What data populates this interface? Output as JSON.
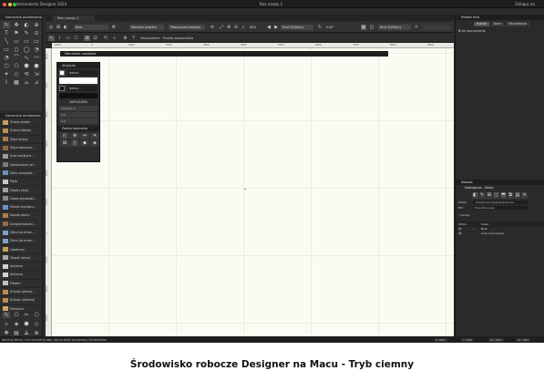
{
  "window": {
    "app_title": "Vectorworks Designer 2020",
    "document_title": "Bez nazwy 1",
    "sign_in": "Zaloguj się"
  },
  "basic_palette": {
    "title": "Narzędzia podstawowe",
    "tools": [
      "↖",
      "✥",
      "◐",
      "⊕",
      "T",
      "⚑",
      "✎",
      "⊙",
      "╲",
      "▭",
      "▭",
      "▭",
      "▭",
      "◻",
      "◯",
      "◔",
      "◔",
      "⌒",
      "∿",
      "〰",
      "⬡",
      "⬠",
      "⬢",
      "⬣",
      "✦",
      "◇",
      "⟲",
      "⇲",
      "⌇",
      "▦",
      "⌓",
      "⊿"
    ]
  },
  "tool_sets": {
    "title": "Narzędzia dodatkowe",
    "items": [
      "Ściana prosta",
      "Ściana łukowa",
      "Złącz ściany",
      "Złącz kompone...",
      "Ściel zwykłymi...",
      "Zakończenie ści...",
      "Skłon przegrod...",
      "Płyta",
      "Otwórz płyty",
      "Ustaw wysokość...",
      "Pomiar wymiaru...",
      "Kopuła dachu",
      "Drzwi/drzwiczki...",
      "Okno lub drzwi...",
      "Okno lub drzwi...",
      "Lokalizery",
      "Słupek (okno)",
      "Kolumna",
      "Kolumna",
      "Pilaster",
      "Schody (pełna)...",
      "Schody (złożone)",
      "Pochylnia"
    ],
    "bottom_icons": [
      "↖",
      "⬠",
      "✂",
      "⬡",
      "⊹",
      "◈",
      "⬢",
      "◇",
      "✥",
      "▤",
      "⟁",
      "⊕"
    ]
  },
  "doc_tab": {
    "label": "Bez nazwy 1"
  },
  "view_bar": {
    "class_select": "Brak",
    "layer_select": "Warstwa projektu",
    "view_select": "Płaszczyzna warstwy",
    "zoom": "62%",
    "scale": "Rzut 2D/Górny",
    "angle": "0,00°",
    "render": "Rzut 2D/Górny"
  },
  "mode_bar": {
    "text": "Zaznaczanie - Punkty zaznaczenia"
  },
  "rulers": {
    "top": [
      "-1000",
      "0",
      "1000",
      "2000",
      "3000",
      "4000",
      "5000",
      "6000",
      "7000",
      "8000",
      "9000"
    ],
    "left": [
      "6000",
      "5000",
      "4000",
      "3000",
      "2000",
      "1000",
      "0",
      "-1000",
      "-2000",
      "-3000"
    ]
  },
  "sheet_bar": {
    "label": "Menedżer zasobów"
  },
  "attributes": {
    "title": "Atrybuty",
    "fill_value": "Jednol...",
    "pen_value": "Jednol...",
    "opacity": "100%/100%",
    "thickness": "Grubość w",
    "line_end": "0,0",
    "line_value": "0,0",
    "snapping_title": "Paleta kontrolna",
    "snap_icons": [
      "◰",
      "⊕",
      "↔",
      "✕",
      "⊞",
      "◫",
      "◆",
      "◈"
    ]
  },
  "obj_info": {
    "title": "Paleta Info",
    "tabs": [
      "Kształt",
      "Dane",
      "Wizualizacja"
    ],
    "active_tab": "Kształt",
    "empty_text": "Brak zaznaczenia"
  },
  "navigation": {
    "header": "Nazwa",
    "title": "Nawigacja - Klasy",
    "toolbar": [
      "◧",
      "✎",
      "⊞",
      "◫",
      "⬒",
      "⧉",
      "▤",
      "✕"
    ],
    "field1_label": "Widok",
    "field1_value": "Pokaż/zmieniaj/wyszukiwanie...",
    "field2_label": "Filtr",
    "field2_value": "Wszystkie klasy",
    "search_label": "Szukaj",
    "col_visibility": "Widzi...",
    "col_name": "Klasa",
    "rows": [
      {
        "eye": "👁",
        "check": "✓",
        "name": "Brak"
      },
      {
        "eye": "👁",
        "check": "",
        "name": "Linie wymiarowe"
      }
    ]
  },
  "status": {
    "text": "Naciśnij Kliknij i Ctrl lub kliknij dwa, aby przejść do pomocy Vectorworks",
    "x": "X: 5803",
    "y": "Y: 1653",
    "dx": "ΔX: 5803",
    "dy": "ΔY: 1653"
  },
  "caption": {
    "text": "Środowisko robocze Designer na Macu - Tryb ciemny"
  },
  "colors": {
    "workspace_bg": "#2b2b2b",
    "drawing_bg": "#fbfbf3",
    "accent": "#4a90d9",
    "traffic_red": "#ff5f57",
    "traffic_yellow": "#febc2e",
    "traffic_green": "#28c840"
  }
}
